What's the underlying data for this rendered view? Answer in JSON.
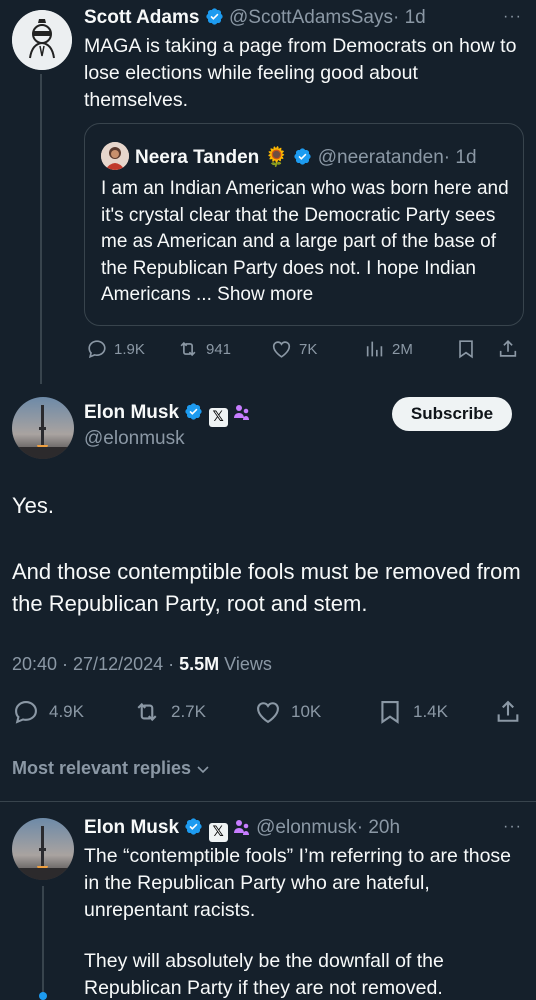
{
  "tweet1": {
    "name": "Scott Adams",
    "handle": "@ScottAdamsSays",
    "time": "· 1d",
    "more": "···",
    "text": "MAGA is taking a page from Democrats on how to lose elections while feeling good about themselves.",
    "quote": {
      "name": "Neera Tanden",
      "emoji": "🌻",
      "handle": "@neeratanden",
      "time": "· 1d",
      "text": "I am an Indian American who was born here and it's crystal clear that the Democratic Party sees me as American and a large part of the base of the Republican Party does not. I hope Indian Americans ... ",
      "show_more": "Show more"
    },
    "actions": {
      "replies": "1.9K",
      "reposts": "941",
      "likes": "7K",
      "views": "2M"
    }
  },
  "main_tweet": {
    "name": "Elon Musk",
    "handle": "@elonmusk",
    "subscribe_label": "Subscribe",
    "text1": "Yes.",
    "text2": "And those contemptible fools must be removed from the Republican Party, root and stem.",
    "timestamp": "20:40 · 27/12/2024 · ",
    "views_count": "5.5M",
    "views_label": " Views",
    "actions": {
      "replies": "4.9K",
      "reposts": "2.7K",
      "likes": "10K",
      "bookmarks": "1.4K"
    }
  },
  "replies_filter": {
    "label": "Most relevant replies"
  },
  "reply": {
    "name": "Elon Musk",
    "handle": "@elonmusk",
    "time": "· 20h",
    "more": "···",
    "text1": "The “contemptible fools” I’m referring to are those in the Republican Party who are hateful, unrepentant racists.",
    "text2": "They will absolutely be the downfall of the Republican Party if they are not removed."
  },
  "colors": {
    "background": "#15202b",
    "accent": "#1d9bf0",
    "muted": "#8b98a5",
    "border": "#38444d"
  },
  "icons": [
    "verified-badge-icon",
    "x-logo-badge-icon",
    "affiliate-people-icon",
    "reply-icon",
    "repost-icon",
    "like-icon",
    "views-icon",
    "bookmark-icon",
    "share-icon",
    "chevron-down-icon",
    "sunflower-emoji"
  ]
}
